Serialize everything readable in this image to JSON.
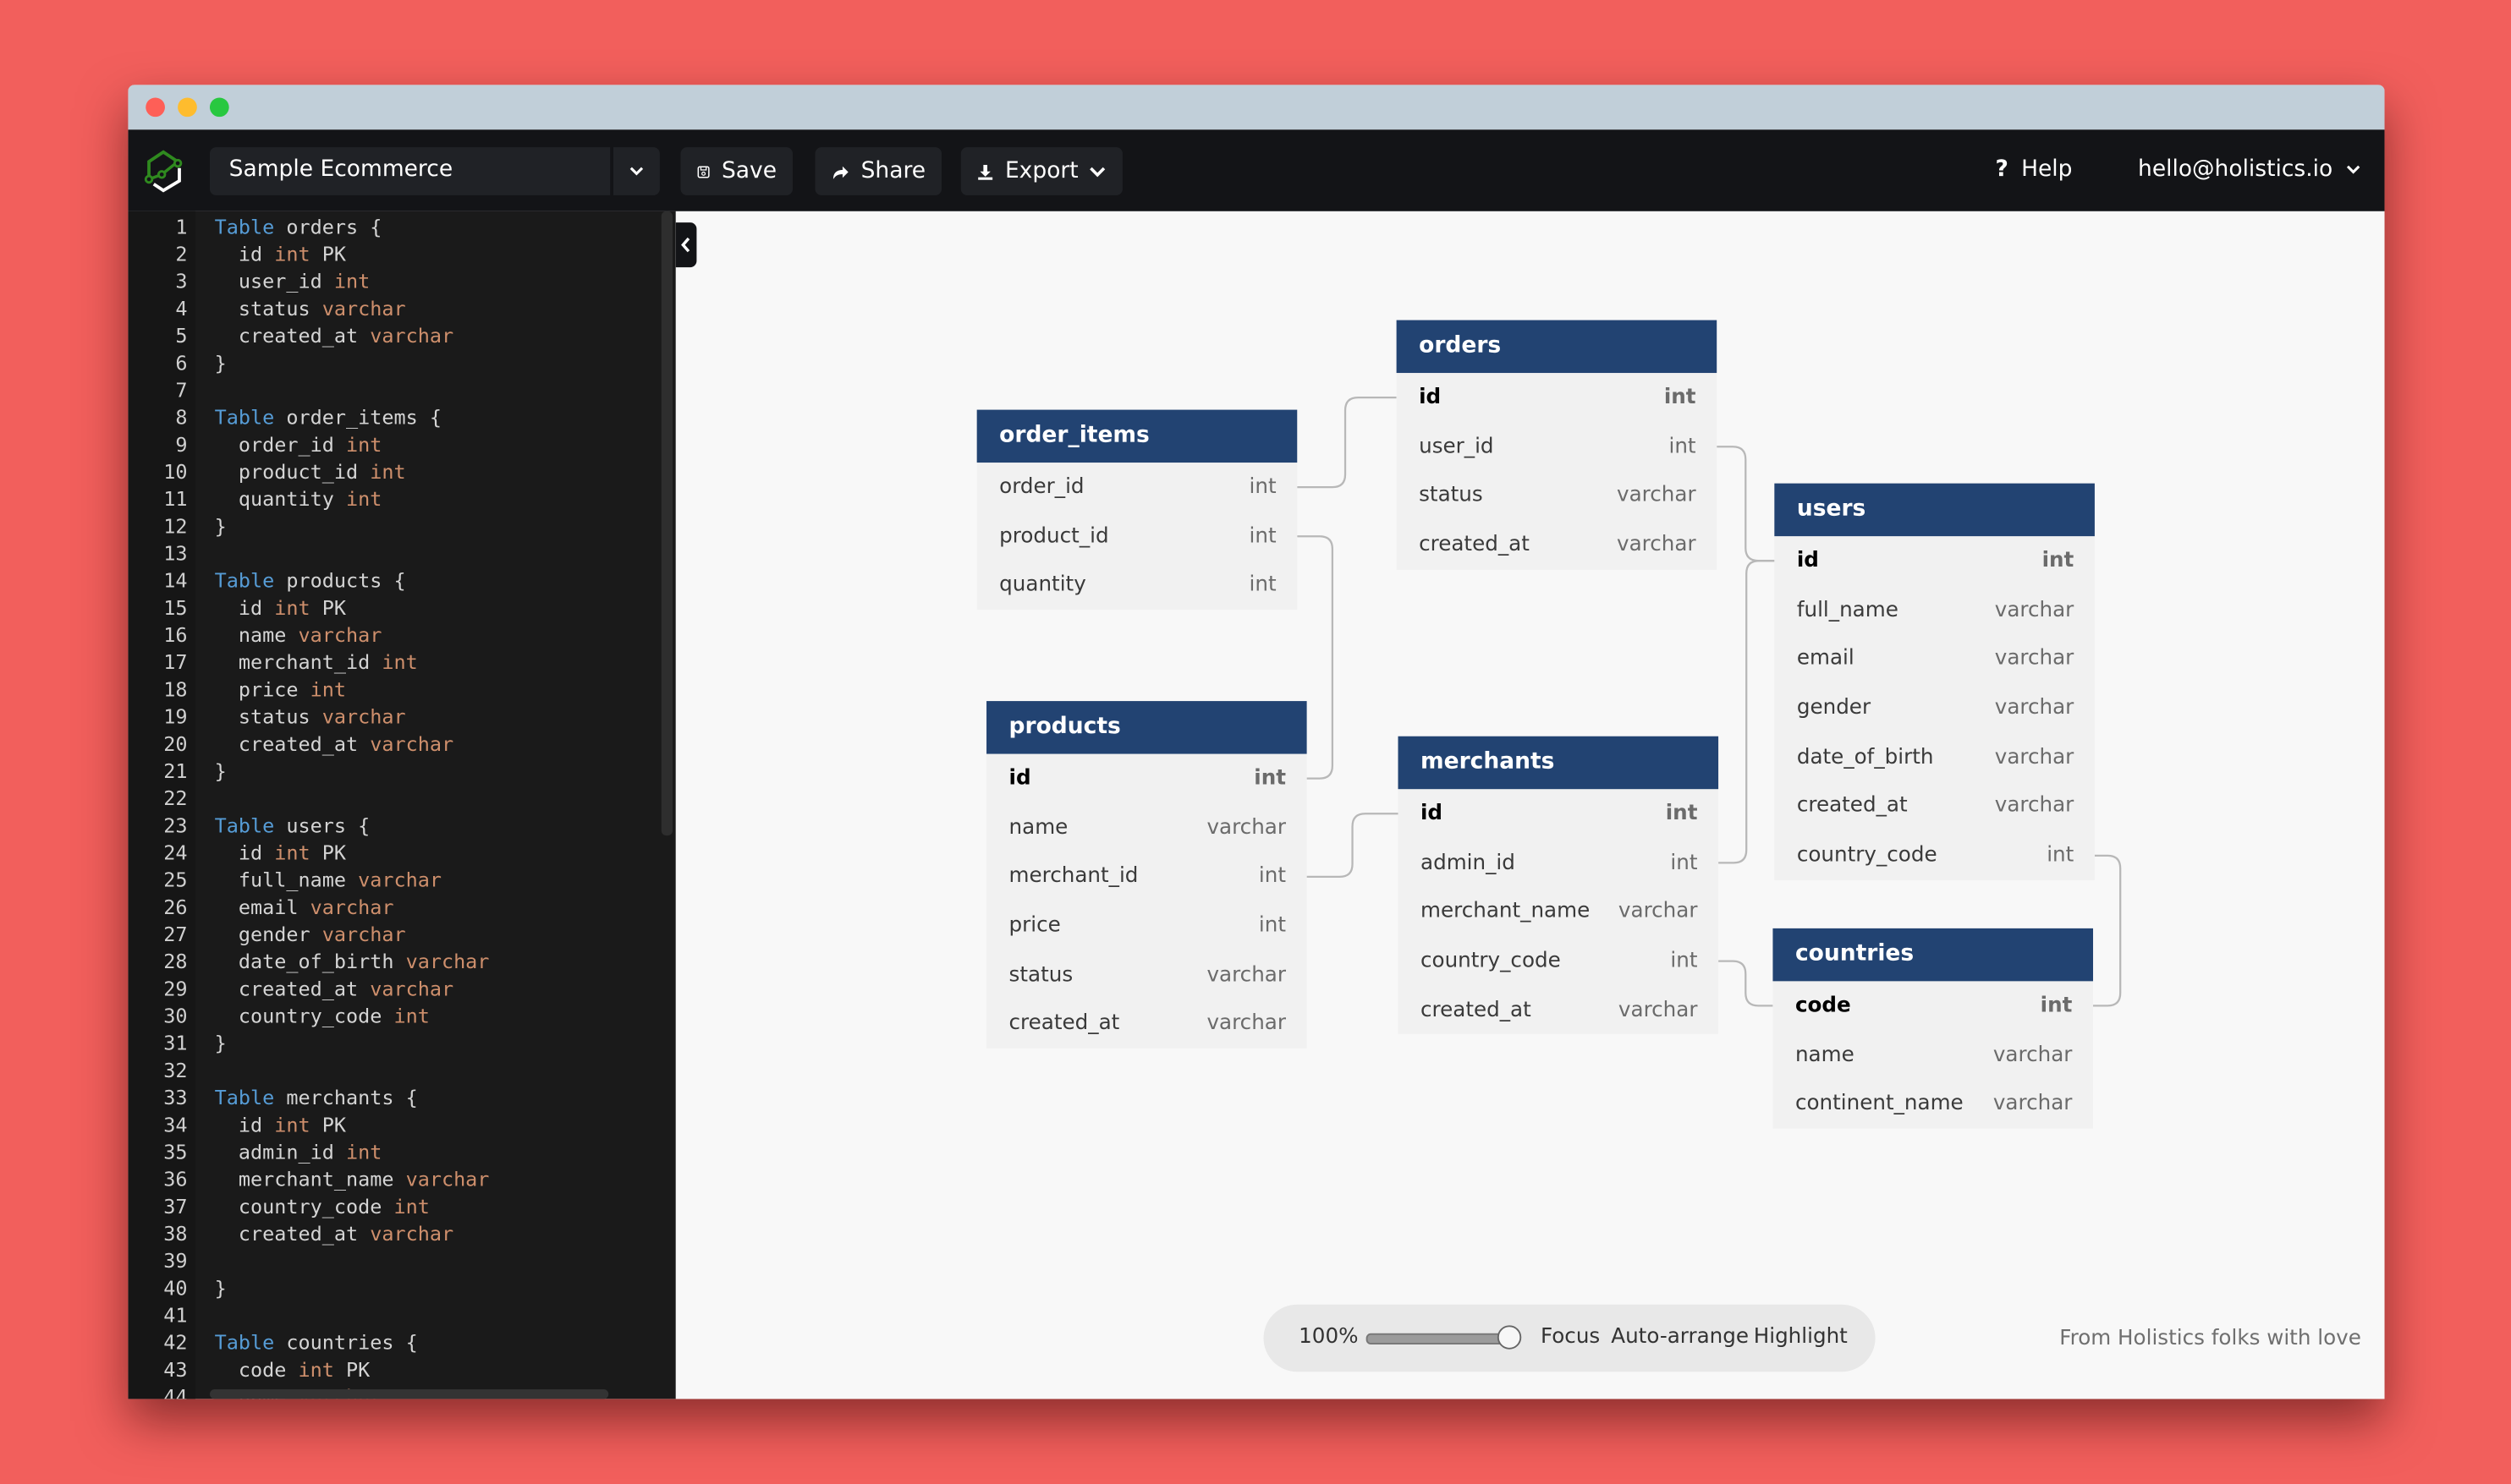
{
  "window": {
    "controls": [
      "close",
      "minimize",
      "maximize"
    ]
  },
  "header": {
    "project_name": "Sample Ecommerce",
    "save_label": "Save",
    "share_label": "Share",
    "export_label": "Export",
    "help_label": "Help",
    "user_email": "hello@holistics.io"
  },
  "editor": {
    "lines": [
      {
        "n": "1",
        "parts": [
          [
            "kw",
            "Table"
          ],
          [
            "tx",
            " orders {"
          ]
        ]
      },
      {
        "n": "2",
        "parts": [
          [
            "tx",
            "  id "
          ],
          [
            "ty",
            "int"
          ],
          [
            "tx",
            " PK"
          ]
        ]
      },
      {
        "n": "3",
        "parts": [
          [
            "tx",
            "  user_id "
          ],
          [
            "ty",
            "int"
          ]
        ]
      },
      {
        "n": "4",
        "parts": [
          [
            "tx",
            "  status "
          ],
          [
            "ty",
            "varchar"
          ]
        ]
      },
      {
        "n": "5",
        "parts": [
          [
            "tx",
            "  created_at "
          ],
          [
            "ty",
            "varchar"
          ]
        ]
      },
      {
        "n": "6",
        "parts": [
          [
            "tx",
            "}"
          ]
        ]
      },
      {
        "n": "7",
        "parts": []
      },
      {
        "n": "8",
        "parts": [
          [
            "kw",
            "Table"
          ],
          [
            "tx",
            " order_items {"
          ]
        ]
      },
      {
        "n": "9",
        "parts": [
          [
            "tx",
            "  order_id "
          ],
          [
            "ty",
            "int"
          ]
        ]
      },
      {
        "n": "10",
        "parts": [
          [
            "tx",
            "  product_id "
          ],
          [
            "ty",
            "int"
          ]
        ]
      },
      {
        "n": "11",
        "parts": [
          [
            "tx",
            "  quantity "
          ],
          [
            "ty",
            "int"
          ]
        ]
      },
      {
        "n": "12",
        "parts": [
          [
            "tx",
            "}"
          ]
        ]
      },
      {
        "n": "13",
        "parts": []
      },
      {
        "n": "14",
        "parts": [
          [
            "kw",
            "Table"
          ],
          [
            "tx",
            " products {"
          ]
        ]
      },
      {
        "n": "15",
        "parts": [
          [
            "tx",
            "  id "
          ],
          [
            "ty",
            "int"
          ],
          [
            "tx",
            " PK"
          ]
        ]
      },
      {
        "n": "16",
        "parts": [
          [
            "tx",
            "  name "
          ],
          [
            "ty",
            "varchar"
          ]
        ]
      },
      {
        "n": "17",
        "parts": [
          [
            "tx",
            "  merchant_id "
          ],
          [
            "ty",
            "int"
          ]
        ]
      },
      {
        "n": "18",
        "parts": [
          [
            "tx",
            "  price "
          ],
          [
            "ty",
            "int"
          ]
        ]
      },
      {
        "n": "19",
        "parts": [
          [
            "tx",
            "  status "
          ],
          [
            "ty",
            "varchar"
          ]
        ]
      },
      {
        "n": "20",
        "parts": [
          [
            "tx",
            "  created_at "
          ],
          [
            "ty",
            "varchar"
          ]
        ]
      },
      {
        "n": "21",
        "parts": [
          [
            "tx",
            "}"
          ]
        ]
      },
      {
        "n": "22",
        "parts": []
      },
      {
        "n": "23",
        "parts": [
          [
            "kw",
            "Table"
          ],
          [
            "tx",
            " users {"
          ]
        ]
      },
      {
        "n": "24",
        "parts": [
          [
            "tx",
            "  id "
          ],
          [
            "ty",
            "int"
          ],
          [
            "tx",
            " PK"
          ]
        ]
      },
      {
        "n": "25",
        "parts": [
          [
            "tx",
            "  full_name "
          ],
          [
            "ty",
            "varchar"
          ]
        ]
      },
      {
        "n": "26",
        "parts": [
          [
            "tx",
            "  email "
          ],
          [
            "ty",
            "varchar"
          ]
        ]
      },
      {
        "n": "27",
        "parts": [
          [
            "tx",
            "  gender "
          ],
          [
            "ty",
            "varchar"
          ]
        ]
      },
      {
        "n": "28",
        "parts": [
          [
            "tx",
            "  date_of_birth "
          ],
          [
            "ty",
            "varchar"
          ]
        ]
      },
      {
        "n": "29",
        "parts": [
          [
            "tx",
            "  created_at "
          ],
          [
            "ty",
            "varchar"
          ]
        ]
      },
      {
        "n": "30",
        "parts": [
          [
            "tx",
            "  country_code "
          ],
          [
            "ty",
            "int"
          ]
        ]
      },
      {
        "n": "31",
        "parts": [
          [
            "tx",
            "}"
          ]
        ]
      },
      {
        "n": "32",
        "parts": []
      },
      {
        "n": "33",
        "parts": [
          [
            "kw",
            "Table"
          ],
          [
            "tx",
            " merchants {"
          ]
        ]
      },
      {
        "n": "34",
        "parts": [
          [
            "tx",
            "  id "
          ],
          [
            "ty",
            "int"
          ],
          [
            "tx",
            " PK"
          ]
        ]
      },
      {
        "n": "35",
        "parts": [
          [
            "tx",
            "  admin_id "
          ],
          [
            "ty",
            "int"
          ]
        ]
      },
      {
        "n": "36",
        "parts": [
          [
            "tx",
            "  merchant_name "
          ],
          [
            "ty",
            "varchar"
          ]
        ]
      },
      {
        "n": "37",
        "parts": [
          [
            "tx",
            "  country_code "
          ],
          [
            "ty",
            "int"
          ]
        ]
      },
      {
        "n": "38",
        "parts": [
          [
            "tx",
            "  created_at "
          ],
          [
            "ty",
            "varchar"
          ]
        ]
      },
      {
        "n": "39",
        "parts": []
      },
      {
        "n": "40",
        "parts": [
          [
            "tx",
            "}"
          ]
        ]
      },
      {
        "n": "41",
        "parts": []
      },
      {
        "n": "42",
        "parts": [
          [
            "kw",
            "Table"
          ],
          [
            "tx",
            " countries {"
          ]
        ]
      },
      {
        "n": "43",
        "parts": [
          [
            "tx",
            "  code "
          ],
          [
            "ty",
            "int"
          ],
          [
            "tx",
            " PK"
          ]
        ]
      },
      {
        "n": "44",
        "parts": [
          [
            "tx",
            "  name "
          ],
          [
            "ty",
            "varchar"
          ]
        ]
      }
    ]
  },
  "diagram": {
    "tables": [
      {
        "id": "orders",
        "name": "orders",
        "columns": [
          {
            "name": "id",
            "type": "int",
            "pk": true
          },
          {
            "name": "user_id",
            "type": "int"
          },
          {
            "name": "status",
            "type": "varchar"
          },
          {
            "name": "created_at",
            "type": "varchar"
          }
        ]
      },
      {
        "id": "order_items",
        "name": "order_items",
        "columns": [
          {
            "name": "order_id",
            "type": "int"
          },
          {
            "name": "product_id",
            "type": "int"
          },
          {
            "name": "quantity",
            "type": "int"
          }
        ]
      },
      {
        "id": "users",
        "name": "users",
        "columns": [
          {
            "name": "id",
            "type": "int",
            "pk": true
          },
          {
            "name": "full_name",
            "type": "varchar"
          },
          {
            "name": "email",
            "type": "varchar"
          },
          {
            "name": "gender",
            "type": "varchar"
          },
          {
            "name": "date_of_birth",
            "type": "varchar"
          },
          {
            "name": "created_at",
            "type": "varchar"
          },
          {
            "name": "country_code",
            "type": "int"
          }
        ]
      },
      {
        "id": "products",
        "name": "products",
        "columns": [
          {
            "name": "id",
            "type": "int",
            "pk": true
          },
          {
            "name": "name",
            "type": "varchar"
          },
          {
            "name": "merchant_id",
            "type": "int"
          },
          {
            "name": "price",
            "type": "int"
          },
          {
            "name": "status",
            "type": "varchar"
          },
          {
            "name": "created_at",
            "type": "varchar"
          }
        ]
      },
      {
        "id": "merchants",
        "name": "merchants",
        "columns": [
          {
            "name": "id",
            "type": "int",
            "pk": true
          },
          {
            "name": "admin_id",
            "type": "int"
          },
          {
            "name": "merchant_name",
            "type": "varchar"
          },
          {
            "name": "country_code",
            "type": "int"
          },
          {
            "name": "created_at",
            "type": "varchar"
          }
        ]
      },
      {
        "id": "countries",
        "name": "countries",
        "columns": [
          {
            "name": "code",
            "type": "int",
            "pk": true
          },
          {
            "name": "name",
            "type": "varchar"
          },
          {
            "name": "continent_name",
            "type": "varchar"
          }
        ]
      }
    ],
    "relationships": [
      {
        "from": "order_items.order_id",
        "to": "orders.id"
      },
      {
        "from": "order_items.product_id",
        "to": "products.id"
      },
      {
        "from": "orders.user_id",
        "to": "users.id"
      },
      {
        "from": "products.merchant_id",
        "to": "merchants.id"
      },
      {
        "from": "merchants.admin_id",
        "to": "users.id"
      },
      {
        "from": "merchants.country_code",
        "to": "countries.code"
      },
      {
        "from": "users.country_code",
        "to": "countries.code"
      }
    ]
  },
  "toolbar": {
    "zoom_label": "100%",
    "zoom_value": 1.0,
    "focus_label": "Focus",
    "auto_arrange_label": "Auto-arrange",
    "highlight_label": "Highlight"
  },
  "footer": {
    "credit": "From Holistics folks with love"
  },
  "colors": {
    "background": "#f25f5c",
    "table_header": "#224372",
    "app_bar": "#131417",
    "keyword": "#569cd6",
    "type": "#ce8f6c"
  }
}
